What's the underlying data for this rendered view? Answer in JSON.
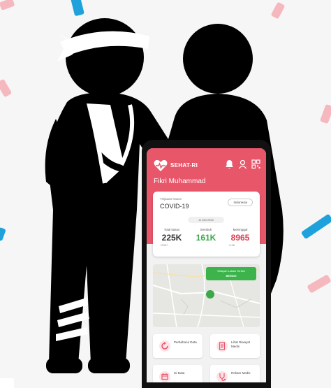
{
  "app": {
    "name": "SEHAT-RI",
    "user_name": "Fikri Muhammad"
  },
  "summary_card": {
    "subtitle": "Tinjauan Kasus",
    "title": "COVID-19",
    "country": "Indonesia",
    "date": "11 Mei 2020",
    "stats": [
      {
        "label": "Total kasus",
        "value": "225K",
        "sub": "+2307",
        "color": "#333333"
      },
      {
        "label": "Sembuh",
        "value": "161K",
        "sub": "",
        "color": "#3aa84a"
      },
      {
        "label": "Meninggal",
        "value": "8965",
        "sub": "+136",
        "color": "#e23b4f"
      }
    ]
  },
  "map": {
    "button_line1": "Wilayah Lokasi Terkini",
    "button_line2": "BERSIH"
  },
  "tiles": [
    {
      "label": "Perbaharui Data",
      "icon": "refresh-icon"
    },
    {
      "label": "Lihat Riwayat Medis",
      "icon": "document-icon"
    },
    {
      "label": "Isi Data",
      "icon": "calendar-icon"
    },
    {
      "label": "Rekam Medis",
      "icon": "stethoscope-icon"
    }
  ],
  "colors": {
    "brand": "#e8566a",
    "accent_green": "#3cb44b",
    "deco_blue": "#1fa2dc",
    "deco_pink": "#f6b8bf"
  }
}
